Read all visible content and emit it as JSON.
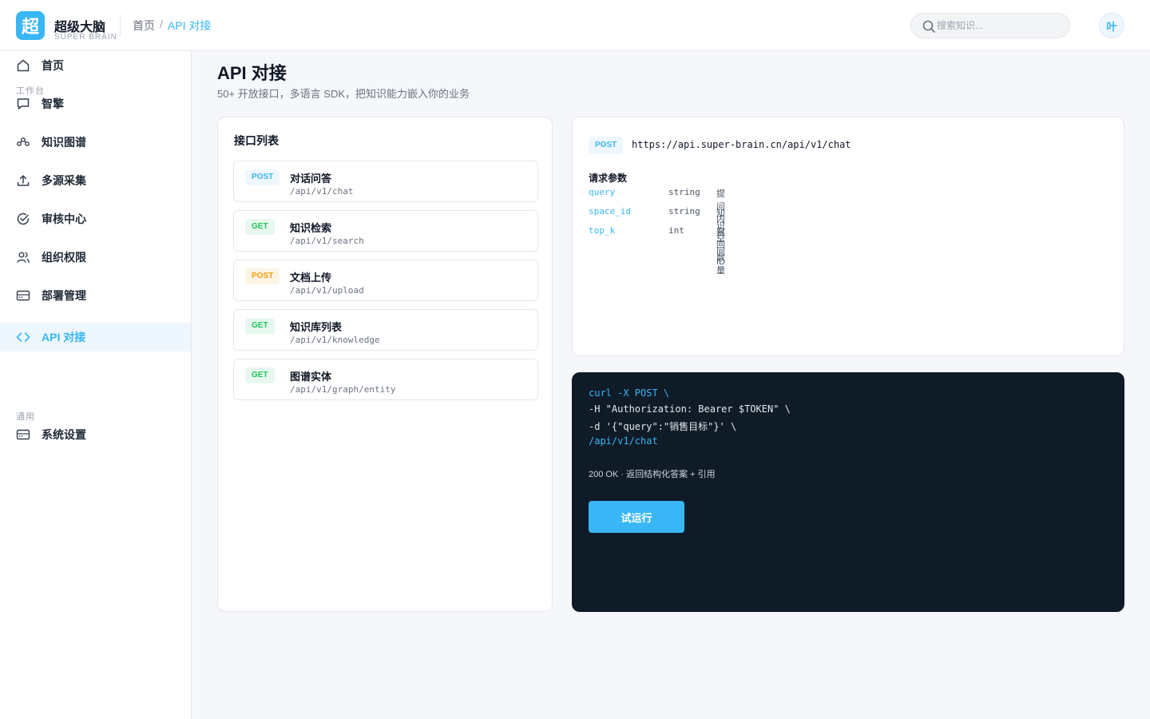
{
  "brand": {
    "logo_char": "超",
    "name": "超级大脑",
    "subtitle": "SUPER BRAIN"
  },
  "breadcrumb": {
    "home": "首页",
    "separator": "/",
    "current": "API 对接"
  },
  "search": {
    "placeholder": "搜索知识..."
  },
  "user": {
    "avatar_text": "叶"
  },
  "sidebar": {
    "items": [
      {
        "label": "首页",
        "icon": "home-icon",
        "active": false
      },
      {
        "label": "智擎",
        "icon": "chat-bubble-icon",
        "active": false
      },
      {
        "label": "知识图谱",
        "icon": "graph-icon",
        "active": false
      },
      {
        "label": "多源采集",
        "icon": "upload-icon",
        "active": false
      },
      {
        "label": "审核中心",
        "icon": "check-circle-icon",
        "active": false
      },
      {
        "label": "组织权限",
        "icon": "users-icon",
        "active": false
      },
      {
        "label": "部署管理",
        "icon": "server-icon",
        "active": false
      },
      {
        "label": "API 对接",
        "icon": "code-icon",
        "active": true
      }
    ],
    "group_workspace": "工作台",
    "group_general": "通用",
    "settings": {
      "label": "系统设置",
      "icon": "settings-panel-icon"
    }
  },
  "page": {
    "title": "API 对接",
    "subtitle": "50+ 开放接口，多语言 SDK，把知识能力嵌入你的业务"
  },
  "api_list": {
    "title": "接口列表",
    "items": [
      {
        "method": "POST",
        "name": "对话问答",
        "path": "/api/v1/chat",
        "badge_color": "#38b6f5"
      },
      {
        "method": "GET",
        "name": "知识检索",
        "path": "/api/v1/search",
        "badge_color": "#22c55e"
      },
      {
        "method": "POST",
        "name": "文档上传",
        "path": "/api/v1/upload",
        "badge_color": "#f59e0b"
      },
      {
        "method": "GET",
        "name": "知识库列表",
        "path": "/api/v1/knowledge",
        "badge_color": "#22c55e"
      },
      {
        "method": "GET",
        "name": "图谱实体",
        "path": "/api/v1/graph/entity",
        "badge_color": "#22c55e"
      }
    ]
  },
  "detail": {
    "method": "POST",
    "url": "https://api.super-brain.cn/api/v1/chat",
    "params_title": "请求参数",
    "params": [
      {
        "name": "query",
        "type": "string",
        "desc": "提问内容"
      },
      {
        "name": "space_id",
        "type": "string",
        "desc": "知识空间 ID"
      },
      {
        "name": "top_k",
        "type": "int",
        "desc": "召回数量"
      }
    ]
  },
  "code": {
    "lines": [
      "curl -X POST \\",
      "-H \"Authorization: Bearer $TOKEN\" \\",
      "-d '{\"query\":\"销售目标\"}' \\",
      "/api/v1/chat"
    ],
    "response": "200 OK · 返回结构化答案 + 引用",
    "run_label": "试运行"
  },
  "colors": {
    "accent": "#38b6f5",
    "get": "#22c55e",
    "warn": "#f59e0b",
    "code_bg": "#0f1b27"
  }
}
